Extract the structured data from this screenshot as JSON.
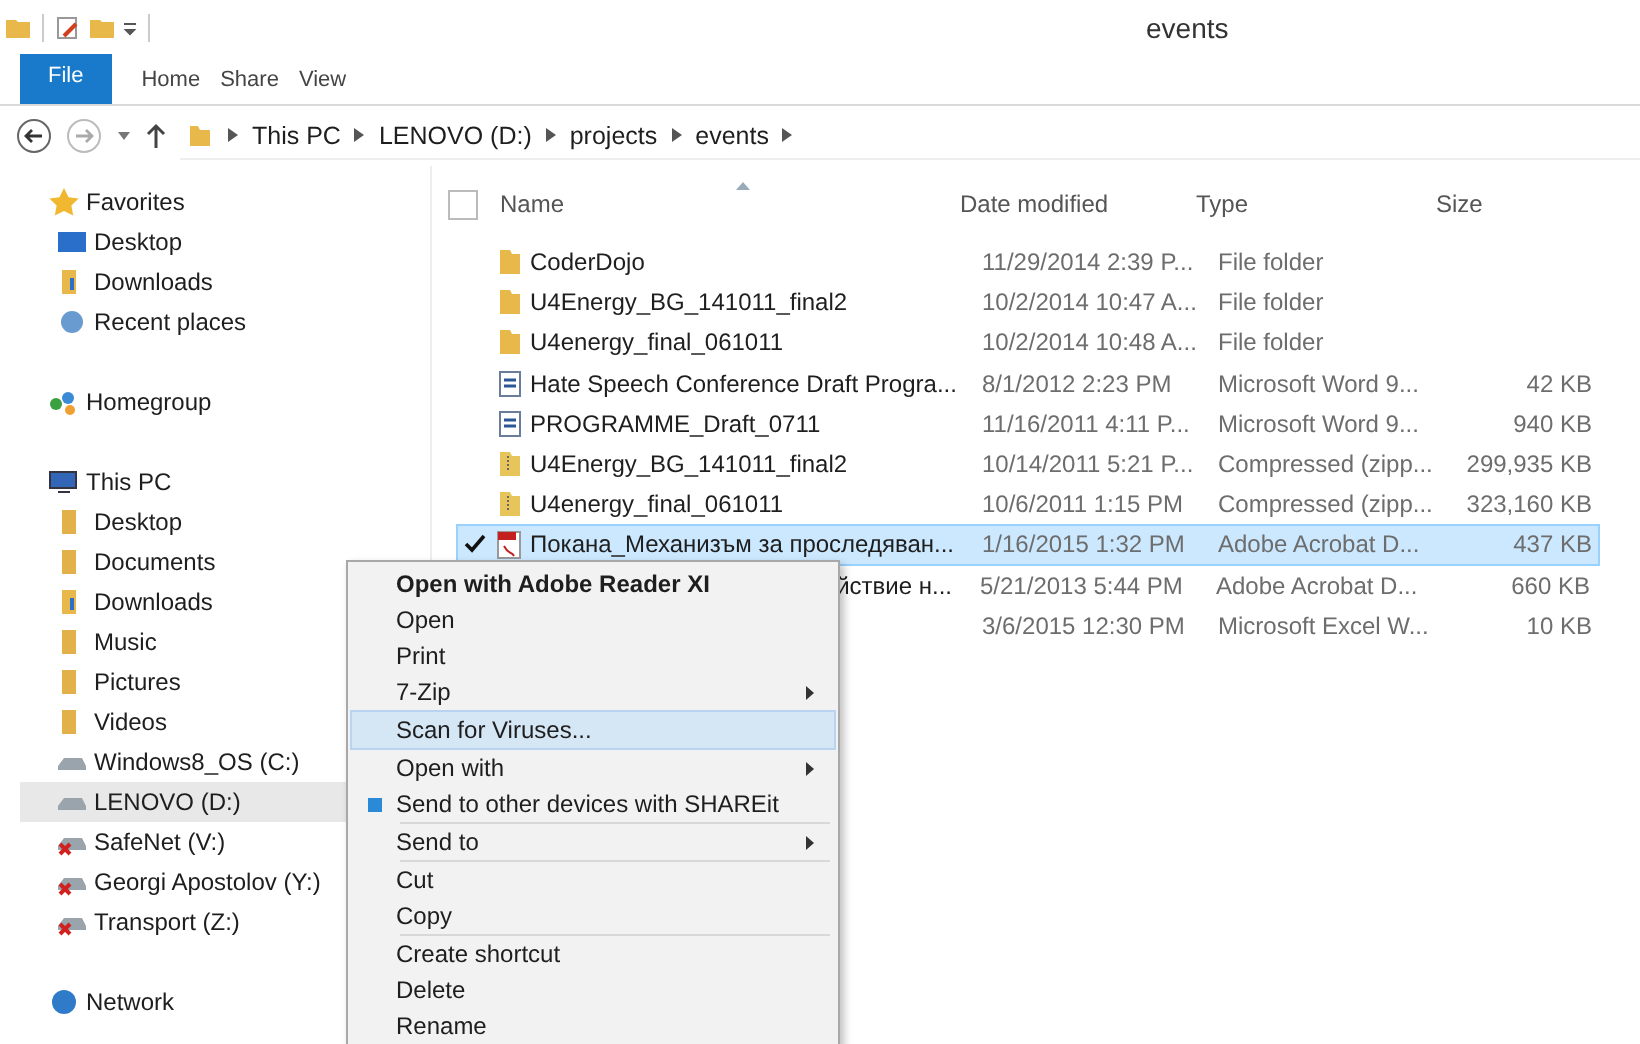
{
  "window": {
    "title": "events"
  },
  "ribbon_tabs": [
    {
      "label": "File",
      "selected": true
    },
    {
      "label": "Home",
      "selected": false
    },
    {
      "label": "Share",
      "selected": false
    },
    {
      "label": "View",
      "selected": false
    }
  ],
  "breadcrumb": [
    "This PC",
    "LENOVO (D:)",
    "projects",
    "events"
  ],
  "sidebar": {
    "groups": [
      {
        "label": "Favorites",
        "kind": "star",
        "selected": false,
        "children": [
          {
            "label": "Desktop",
            "kind": "desktop",
            "selected": false
          },
          {
            "label": "Downloads",
            "kind": "download",
            "selected": false
          },
          {
            "label": "Recent places",
            "kind": "recent",
            "selected": false
          }
        ]
      },
      {
        "label": "Homegroup",
        "kind": "homegroup",
        "selected": false
      },
      {
        "label": "This PC",
        "kind": "pc",
        "selected": false,
        "children": [
          {
            "label": "Desktop",
            "kind": "folder",
            "selected": false
          },
          {
            "label": "Documents",
            "kind": "folder",
            "selected": false
          },
          {
            "label": "Downloads",
            "kind": "download",
            "selected": false
          },
          {
            "label": "Music",
            "kind": "folder",
            "selected": false
          },
          {
            "label": "Pictures",
            "kind": "folder",
            "selected": false
          },
          {
            "label": "Videos",
            "kind": "folder",
            "selected": false
          },
          {
            "label": "Windows8_OS (C:)",
            "kind": "drive",
            "selected": false
          },
          {
            "label": "LENOVO (D:)",
            "kind": "drive",
            "selected": true
          },
          {
            "label": "SafeNet (V:)",
            "kind": "netdrive",
            "selected": false
          },
          {
            "label": "Georgi Apostolov (Y:)",
            "kind": "netdrive",
            "selected": false
          },
          {
            "label": "Transport (Z:)",
            "kind": "netdrive",
            "selected": false
          }
        ]
      },
      {
        "label": "Network",
        "kind": "network",
        "selected": false
      }
    ]
  },
  "table": {
    "columns": [
      "Name",
      "Date modified",
      "Type",
      "Size"
    ],
    "all_checked": false,
    "rows": [
      {
        "kind": "folder",
        "name": "CoderDojo",
        "date": "11/29/2014 2:39 P...",
        "type": "File folder",
        "selected": false,
        "checked": false
      },
      {
        "kind": "folder",
        "name": "U4Energy_BG_141011_final2",
        "date": "10/2/2014 10:47 A...",
        "type": "File folder",
        "selected": false,
        "checked": false
      },
      {
        "kind": "folder",
        "name": "U4energy_final_061011",
        "date": "10/2/2014 10:48 A...",
        "type": "File folder",
        "selected": false,
        "checked": false
      },
      {
        "kind": "word",
        "name": "Hate Speech Conference Draft Progra...",
        "date": "8/1/2012 2:23 PM",
        "type": "Microsoft Word 9...",
        "size": "42 KB",
        "selected": false,
        "checked": false
      },
      {
        "kind": "word",
        "name": "PROGRAMME_Draft_0711",
        "date": "11/16/2011 4:11 P...",
        "type": "Microsoft Word 9...",
        "size": "940 KB",
        "selected": false,
        "checked": false
      },
      {
        "kind": "zip",
        "name": "U4Energy_BG_141011_final2",
        "date": "10/14/2011 5:21 P...",
        "type": "Compressed (zipp...",
        "size": "299,935 KB",
        "selected": false,
        "checked": false
      },
      {
        "kind": "zip",
        "name": "U4energy_final_061011",
        "date": "10/6/2011 1:15 PM",
        "type": "Compressed (zipp...",
        "size": "323,160 KB",
        "selected": false,
        "checked": false
      },
      {
        "kind": "pdf",
        "name": "Покана_Механизъм за проследяван...",
        "date": "1/16/2015 1:32 PM",
        "type": "Adobe Acrobat D...",
        "size": "437 KB",
        "selected": true,
        "checked": true
      },
      {
        "kind": "covered",
        "name": "йствие н...",
        "date": "5/21/2013 5:44 PM",
        "type": "Adobe Acrobat D...",
        "size": "660 KB",
        "selected": false,
        "checked": false
      },
      {
        "kind": "covered",
        "date": "3/6/2015 12:30 PM",
        "type": "Microsoft Excel W...",
        "size": "10 KB",
        "selected": false,
        "checked": false
      }
    ]
  },
  "context_menu": {
    "groups": [
      [
        {
          "label": "Open with Adobe Reader XI",
          "bold": true,
          "submenu": false,
          "selected": false
        },
        {
          "label": "Open",
          "bold": false,
          "submenu": false,
          "selected": false
        },
        {
          "label": "Print",
          "bold": false,
          "submenu": false,
          "selected": false
        },
        {
          "label": "7-Zip",
          "bold": false,
          "submenu": true,
          "selected": false
        }
      ],
      [
        {
          "label": "Scan for Viruses...",
          "bold": false,
          "submenu": false,
          "selected": true
        }
      ],
      [
        {
          "label": "Open with",
          "bold": false,
          "submenu": true,
          "selected": false
        },
        {
          "label": "Send to other devices with SHAREit",
          "bold": false,
          "submenu": false,
          "selected": false,
          "kind": "shareit"
        }
      ],
      [
        {
          "label": "Send to",
          "bold": false,
          "submenu": true,
          "selected": false
        }
      ],
      [
        {
          "label": "Cut",
          "bold": false,
          "submenu": false,
          "selected": false
        },
        {
          "label": "Copy",
          "bold": false,
          "submenu": false,
          "selected": false
        }
      ],
      [
        {
          "label": "Create shortcut",
          "bold": false,
          "submenu": false,
          "selected": false
        },
        {
          "label": "Delete",
          "bold": false,
          "submenu": false,
          "selected": false
        },
        {
          "label": "Rename",
          "bold": false,
          "submenu": false,
          "selected": false
        }
      ]
    ]
  }
}
